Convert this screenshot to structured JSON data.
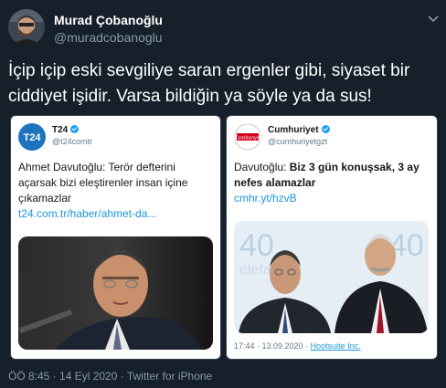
{
  "author": {
    "display_name": "Murad Çobanoğlu",
    "handle": "@muradcobanoglu"
  },
  "tweet": {
    "text": "İçip içip eski sevgiliye saran ergenler gibi, siyaset bir ciddiyet işidir. Varsa bildiğin ya söyle ya da sus!"
  },
  "cards": [
    {
      "name": "T24",
      "handle": "@t24comtr",
      "logo_text": "T24",
      "text": "Ahmet Davutoğlu: Terör defterini açarsak bizi eleştirenler insan içine çıkamazlar",
      "link": "t24.com.tr/haber/ahmet-da..."
    },
    {
      "name": "Cumhuriyet",
      "handle": "@cumhuriyetgzt",
      "logo_text": "Cumhuriyet",
      "text_prefix": "Davutoğlu: ",
      "text_bold": "Biz 3 gün konuşsak, 3 ay nefes alamazlar",
      "link": "cmhr.yt/hzvB",
      "photo_bg_text": "40",
      "time": "17:44 · 13.09.2020 · ",
      "source": "Hootsuite Inc."
    }
  ],
  "footer": "ÖÖ 8:45 · 14 Eyl 2020 · Twitter for iPhone",
  "icons": [
    "avatar-photo",
    "chevron-down-icon",
    "verified-icon"
  ],
  "colors": {
    "background": "#15202b",
    "secondary_text": "#8899a6",
    "link": "#1b95e0",
    "t24_brand": "#1e73be",
    "cumhuriyet_brand": "#d0021b"
  }
}
